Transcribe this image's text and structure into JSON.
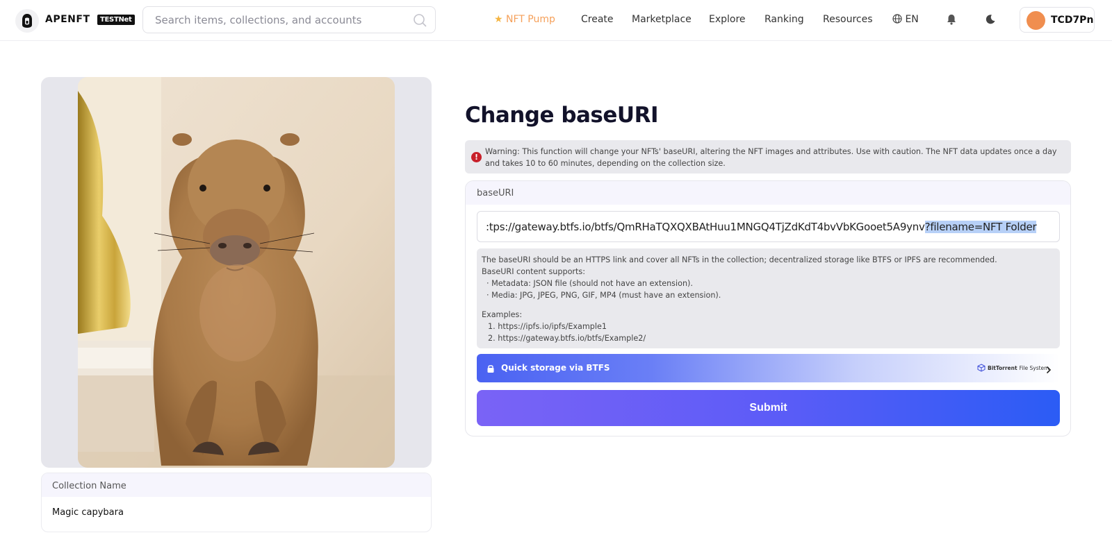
{
  "header": {
    "logo_text": "APENFT",
    "badge": "TESTNet",
    "search_placeholder": "Search items, collections, and accounts",
    "nav": {
      "pump": "NFT Pump",
      "create": "Create",
      "marketplace": "Marketplace",
      "explore": "Explore",
      "ranking": "Ranking",
      "resources": "Resources",
      "language": "EN"
    },
    "account_name": "TCD7Pn"
  },
  "collection": {
    "label": "Collection Name",
    "value": "Magic capybara"
  },
  "main": {
    "title": "Change baseURI",
    "warning": "Warning: This function will change your NFTs' baseURI, altering the NFT images and attributes. Use with caution. The NFT data updates once a day and takes 10 to 60 minutes, depending on the collection size.",
    "field_label": "baseURI",
    "uri_value_visible": ":tps://gateway.btfs.io/btfs/QmRHaTQXQXBAtHuu1MNGQ4TjZdKdT4bvVbKGooet5A9ynv",
    "uri_value_selected": "?filename=NFT Folder",
    "help": {
      "line1": "The baseURI should be an HTTPS link and cover all NFTs in the collection; decentralized storage like BTFS or IPFS are recommended.",
      "line2": "BaseURI content supports:",
      "line3": "· Metadata: JSON file (should not have an extension).",
      "line4": "· Media: JPG, JPEG, PNG, GIF, MP4 (must have an extension).",
      "examples_label": "Examples:",
      "example1": "1. https://ipfs.io/ipfs/Example1",
      "example2": "2. https://gateway.btfs.io/btfs/Example2/"
    },
    "storage_button": "Quick storage via BTFS",
    "btfs_brand": "BitTorrent",
    "btfs_brand_suffix": "File System",
    "submit": "Submit"
  },
  "colors": {
    "accent_orange": "#f5a05a",
    "submit_gradient_start": "#7a63f6",
    "submit_gradient_end": "#2b5cf5",
    "warning_red": "#c8202a"
  }
}
